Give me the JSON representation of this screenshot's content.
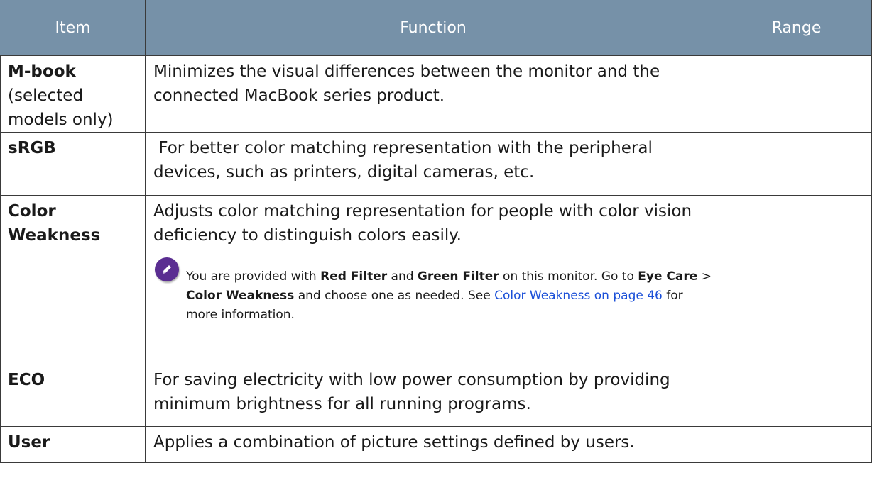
{
  "table": {
    "headers": {
      "item": "Item",
      "function": "Function",
      "range": "Range"
    },
    "rows": [
      {
        "item": "M-book",
        "item_sub": "(selected models only)",
        "function": "Minimizes the visual differences between the monitor and the connected MacBook series product.",
        "range": ""
      },
      {
        "item": "sRGB",
        "function": " For better color matching representation with the peripheral devices, such as printers, digital cameras, etc.",
        "range": ""
      },
      {
        "item": "Color Weakness",
        "function": "Adjusts color matching representation for people with color vision deficiency to distinguish colors easily.",
        "note": {
          "icon": "pencil-note-icon",
          "t1": "You are provided with ",
          "b1": "Red Filter",
          "t2": " and ",
          "b2": "Green Filter",
          "t3": " on this monitor. Go to ",
          "b3": "Eye Care",
          "t4": " > ",
          "b4": "Color Weakness",
          "t5": " and choose one as needed. See ",
          "link": "Color Weakness on page 46",
          "t6": " for more information."
        },
        "range": ""
      },
      {
        "item": "ECO",
        "function": "For saving electricity with low power consumption by providing minimum brightness for all running programs.",
        "range": ""
      },
      {
        "item": "User",
        "function": "Applies a combination of picture settings defined by users.",
        "range": ""
      }
    ]
  },
  "colors": {
    "header_bg": "#7691a8",
    "header_text": "#ffffff",
    "link": "#1a4fd8",
    "note_icon": "#5a2d91"
  }
}
